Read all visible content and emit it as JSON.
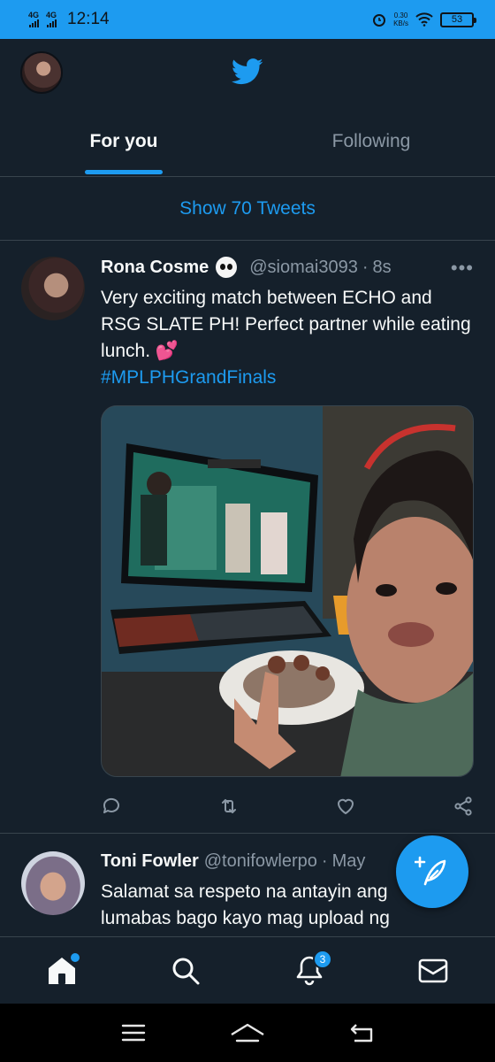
{
  "status_bar": {
    "network1": "4G",
    "network2": "4G",
    "time": "12:14",
    "speed_value": "0.30",
    "speed_unit": "KB/s",
    "battery": "53"
  },
  "tabs": [
    {
      "label": "For you",
      "active": true
    },
    {
      "label": "Following",
      "active": false
    }
  ],
  "show_tweets_label": "Show 70 Tweets",
  "tweets": [
    {
      "name": "Rona Cosme",
      "handle": "@siomai3093",
      "separator": "·",
      "time": "8s",
      "more": "•••",
      "text": "Very exciting match between ECHO and RSG SLATE PH! Perfect partner while eating lunch.",
      "emoji": "💕",
      "hashtag": "#MPLPHGrandFinals"
    },
    {
      "name": "Toni Fowler",
      "handle": "@tonifowlerpo",
      "separator": "·",
      "time": "May",
      "text": "Salamat sa respeto na antayin ang lumabas bago kayo mag upload ng"
    }
  ],
  "bottom_nav": {
    "notifications_badge": "3"
  },
  "colors": {
    "accent": "#1d9bf0",
    "background": "#15202b",
    "muted_text": "#8b98a5",
    "divider": "#38444d"
  }
}
